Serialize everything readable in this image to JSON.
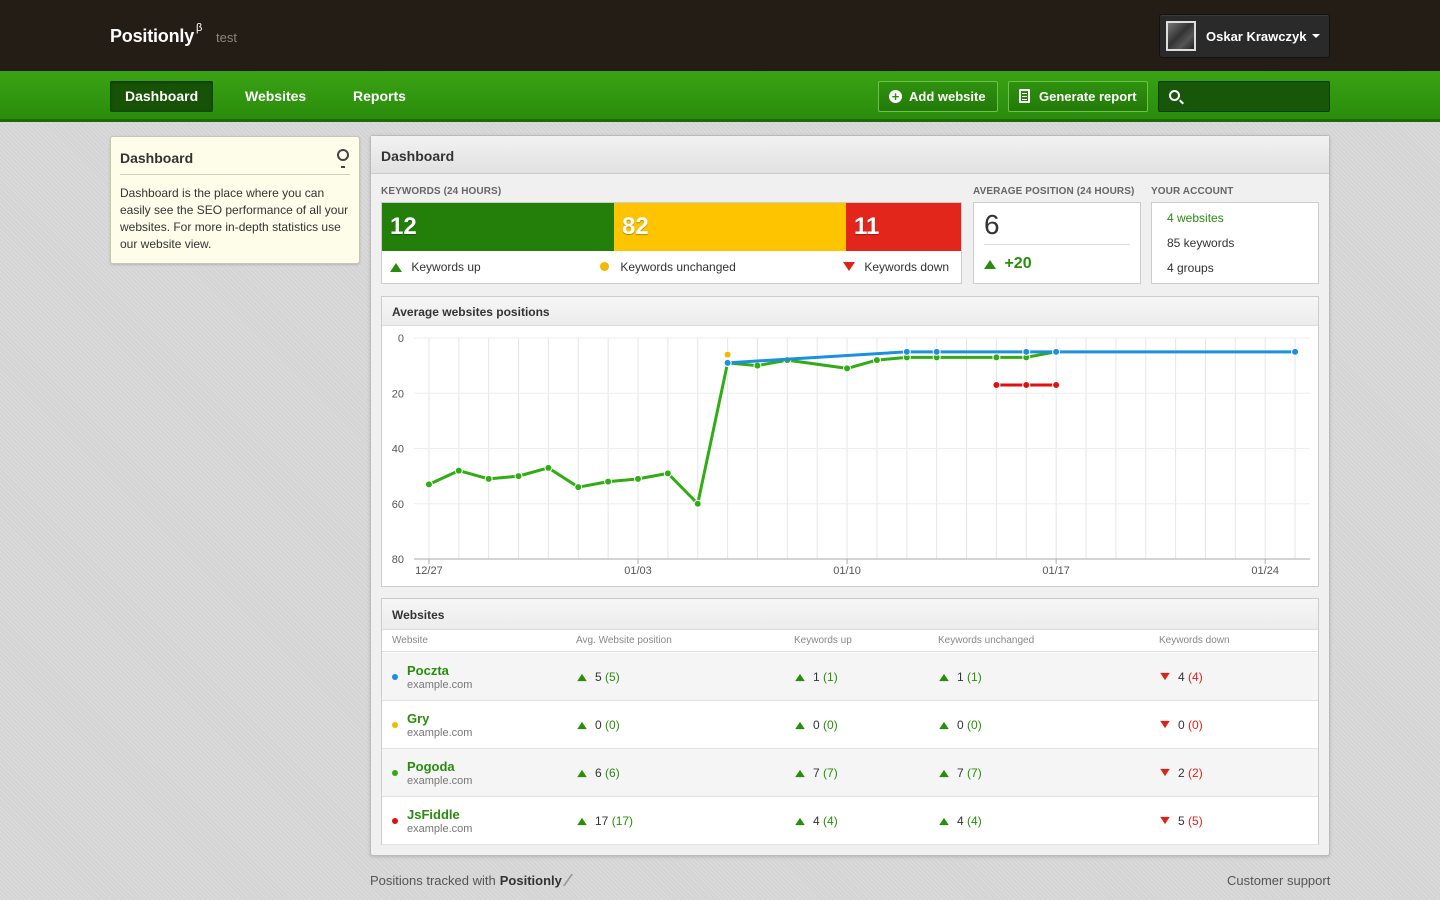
{
  "header": {
    "brand": "Positionly",
    "brand_sup": "β",
    "subtitle": "test",
    "user_name": "Oskar Krawczyk"
  },
  "nav": {
    "items": [
      {
        "label": "Dashboard",
        "active": true
      },
      {
        "label": "Websites",
        "active": false
      },
      {
        "label": "Reports",
        "active": false
      }
    ],
    "add_website": "Add website",
    "generate_report": "Generate report",
    "search_placeholder": ""
  },
  "help": {
    "title": "Dashboard",
    "text": "Dashboard is the place where you can easily see the SEO performance of all your websites. For more in-depth statistics use our website view."
  },
  "main": {
    "title": "Dashboard",
    "keywords": {
      "label": "KEYWORDS (24 HOURS)",
      "up": "12",
      "unchanged": "82",
      "down": "11",
      "legend_up": "Keywords up",
      "legend_unchanged": "Keywords unchanged",
      "legend_down": "Keywords down"
    },
    "average": {
      "label": "AVERAGE POSITION (24 HOURS)",
      "value": "6",
      "change": "+20"
    },
    "account": {
      "label": "YOUR ACCOUNT",
      "websites": "4 websites",
      "keywords": "85 keywords",
      "groups": "4 groups"
    }
  },
  "chart_data": {
    "type": "line",
    "title": "Average websites positions",
    "y_reversed": true,
    "ylim": [
      0,
      80
    ],
    "y_ticks": [
      0,
      20,
      40,
      60,
      80
    ],
    "x_tick_labels": [
      {
        "day": 0,
        "label": "12/27"
      },
      {
        "day": 7,
        "label": "01/03"
      },
      {
        "day": 14,
        "label": "01/10"
      },
      {
        "day": 21,
        "label": "01/17"
      },
      {
        "day": 28,
        "label": "01/24"
      }
    ],
    "x_range_days": [
      -0.5,
      29.5
    ],
    "grid": true,
    "series": [
      {
        "name": "JsFiddle",
        "color": "#2fad12",
        "points": [
          [
            0,
            53
          ],
          [
            1,
            48
          ],
          [
            2,
            51
          ],
          [
            3,
            50
          ],
          [
            4,
            47
          ],
          [
            5,
            54
          ],
          [
            6,
            52
          ],
          [
            7,
            51
          ],
          [
            8,
            49
          ],
          [
            9,
            60
          ],
          [
            10,
            9
          ],
          [
            11,
            10
          ],
          [
            12,
            8
          ],
          [
            14,
            11
          ],
          [
            15,
            8
          ],
          [
            16,
            7
          ],
          [
            17,
            7
          ],
          [
            19,
            7
          ],
          [
            20,
            7
          ],
          [
            21,
            5
          ]
        ]
      },
      {
        "name": "Poczta",
        "color": "#1c8fe0",
        "points": [
          [
            10,
            9
          ],
          [
            16,
            5
          ],
          [
            17,
            5
          ],
          [
            20,
            5
          ],
          [
            21,
            5
          ],
          [
            29,
            5
          ]
        ]
      },
      {
        "name": "Pogoda",
        "color": "#e01010",
        "points": [
          [
            19,
            17
          ],
          [
            20,
            17
          ],
          [
            21,
            17
          ]
        ]
      },
      {
        "name": "Gry",
        "color": "#f5b800",
        "points": [
          [
            10,
            6
          ]
        ]
      }
    ]
  },
  "table": {
    "title": "Websites",
    "headers": [
      "Website",
      "Avg. Website position",
      "Keywords up",
      "Keywords unchanged",
      "Keywords down"
    ],
    "rows": [
      {
        "name": "Poczta",
        "url": "example.com",
        "color": "#1c8fe0",
        "avg": "5",
        "avg_p": "(5)",
        "up": "1",
        "up_p": "(1)",
        "unch": "1",
        "unch_p": "(1)",
        "down": "4",
        "down_p": "(4)"
      },
      {
        "name": "Gry",
        "url": "example.com",
        "color": "#f5b800",
        "avg": "0",
        "avg_p": "(0)",
        "up": "0",
        "up_p": "(0)",
        "unch": "0",
        "unch_p": "(0)",
        "down": "0",
        "down_p": "(0)"
      },
      {
        "name": "Pogoda",
        "url": "example.com",
        "color": "#2fad12",
        "avg": "6",
        "avg_p": "(6)",
        "up": "7",
        "up_p": "(7)",
        "unch": "7",
        "unch_p": "(7)",
        "down": "2",
        "down_p": "(2)"
      },
      {
        "name": "JsFiddle",
        "url": "example.com",
        "color": "#e01010",
        "avg": "17",
        "avg_p": "(17)",
        "up": "4",
        "up_p": "(4)",
        "unch": "4",
        "unch_p": "(4)",
        "down": "5",
        "down_p": "(5)"
      }
    ]
  },
  "footer": {
    "tracked_text": "Positions tracked with",
    "tracked_brand": "Positionly",
    "support": "Customer support"
  },
  "colors": {
    "green": "#2a8c0c",
    "yellow": "#ffc400",
    "red": "#e2261b",
    "topbar": "#241d15"
  }
}
